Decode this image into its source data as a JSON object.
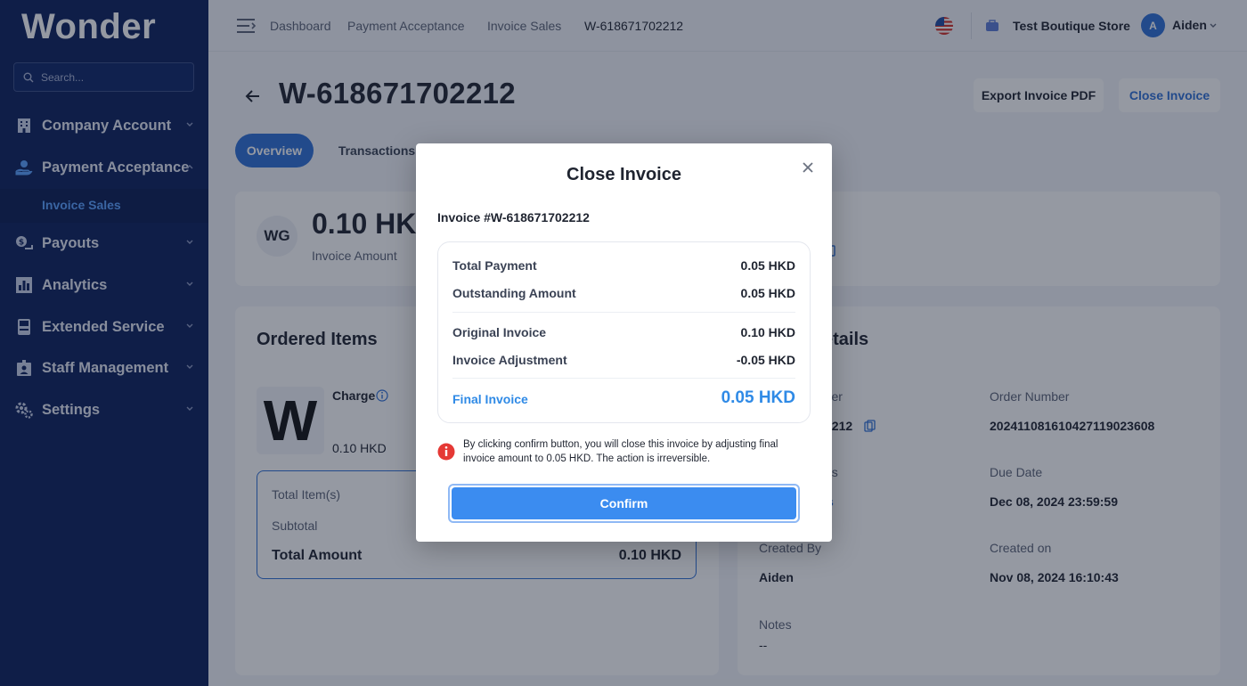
{
  "brand": {
    "logo_text": "Wonder"
  },
  "sidebar": {
    "search_placeholder": "Search...",
    "items": [
      {
        "label": "Company Account",
        "icon": "building-icon"
      },
      {
        "label": "Payment Acceptance",
        "icon": "payment-hand-icon"
      },
      {
        "label": "Payouts",
        "icon": "payouts-icon"
      },
      {
        "label": "Analytics",
        "icon": "bar-chart-icon"
      },
      {
        "label": "Extended Service",
        "icon": "pos-terminal-icon"
      },
      {
        "label": "Staff Management",
        "icon": "staff-icon"
      },
      {
        "label": "Settings",
        "icon": "gear-icon"
      }
    ],
    "sub_item": "Invoice Sales"
  },
  "header": {
    "breadcrumbs": [
      "Dashboard",
      "Payment Acceptance",
      "Invoice Sales",
      "W-618671702212"
    ],
    "store_name": "Test Boutique Store",
    "avatar_letter": "A",
    "user_name": "Aiden"
  },
  "page": {
    "title": "W-618671702212",
    "export_label": "Export Invoice PDF",
    "close_label": "Close Invoice",
    "tabs": [
      "Overview",
      "Transactions"
    ]
  },
  "summary": {
    "badge": "WG",
    "amount": "0.10 HKD",
    "amount_label": "Invoice Amount"
  },
  "ordered_items": {
    "title": "Ordered Items",
    "item_letter": "W",
    "item_name": "Charge",
    "item_price": "0.10 HKD",
    "total_items_label": "Total Item(s)",
    "subtotal_label": "Subtotal",
    "total_amount_label": "Total Amount",
    "total_amount_value": "0.10 HKD"
  },
  "details": {
    "title_fragment": "etails",
    "number_label_fragment": "mber",
    "number_value_fragment": "2212",
    "status_label_fragment": "us",
    "status_value_fragment": "s",
    "order_number_label": "Order Number",
    "order_number_value": "20241108161042711902360​8",
    "due_date_label": "Due Date",
    "due_date_value": "Dec 08, 2024 23:59:59",
    "created_by_label": "Created By",
    "created_by_value": "Aiden",
    "created_on_label": "Created on",
    "created_on_value": "Nov 08, 2024 16:10:43",
    "notes_label": "Notes",
    "notes_value": "--"
  },
  "modal": {
    "title": "Close Invoice",
    "invoice_no": "Invoice #W-618671702212",
    "rows": [
      {
        "label": "Total Payment",
        "value": "0.05 HKD"
      },
      {
        "label": "Outstanding Amount",
        "value": "0.05 HKD"
      },
      {
        "label": "Original Invoice",
        "value": "0.10 HKD"
      },
      {
        "label": "Invoice Adjustment",
        "value": "-0.05 HKD"
      }
    ],
    "final_label": "Final Invoice",
    "final_value": "0.05 HKD",
    "warning": "By clicking confirm button, you will close this invoice by adjusting final invoice amount to 0.05 HKD. The action is irreversible.",
    "confirm_label": "Confirm"
  },
  "colors": {
    "sidebar_bg": "#0b1f5c",
    "accent": "#2f6fd6",
    "final_blue": "#2f8ae6",
    "warning_red": "#e53935"
  }
}
